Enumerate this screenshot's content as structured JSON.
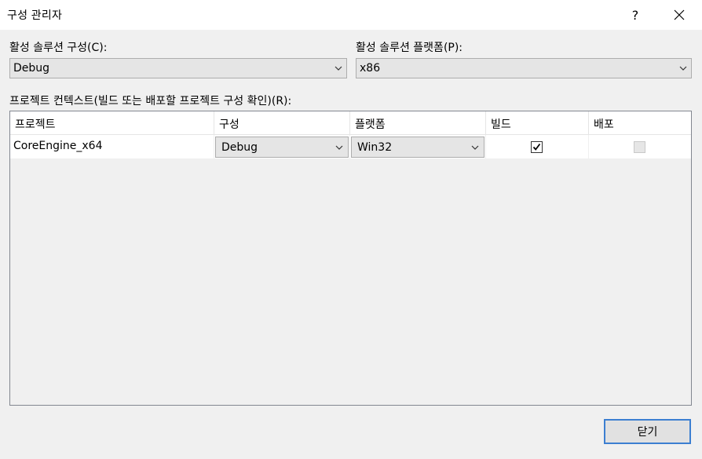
{
  "window": {
    "title": "구성 관리자",
    "help_label": "?",
    "close_label": "✕"
  },
  "active_config": {
    "label": "활성 솔루션 구성(C):",
    "value": "Debug"
  },
  "active_platform": {
    "label": "활성 솔루션 플랫폼(P):",
    "value": "x86"
  },
  "project_contexts": {
    "label": "프로젝트 컨텍스트(빌드 또는 배포할 프로젝트 구성 확인)(R):",
    "columns": [
      "프로젝트",
      "구성",
      "플랫폼",
      "빌드",
      "배포"
    ],
    "rows": [
      {
        "project": "CoreEngine_x64",
        "configuration": "Debug",
        "platform": "Win32",
        "build": true,
        "deploy": false,
        "deploy_enabled": false
      }
    ]
  },
  "footer": {
    "close_button_label": "닫기"
  },
  "icons": {
    "dropdown": "chevron-down-icon",
    "check": "checkmark-icon"
  },
  "colors": {
    "focus_border": "#3c7fd1",
    "dialog_bg": "#f0f0f0"
  }
}
